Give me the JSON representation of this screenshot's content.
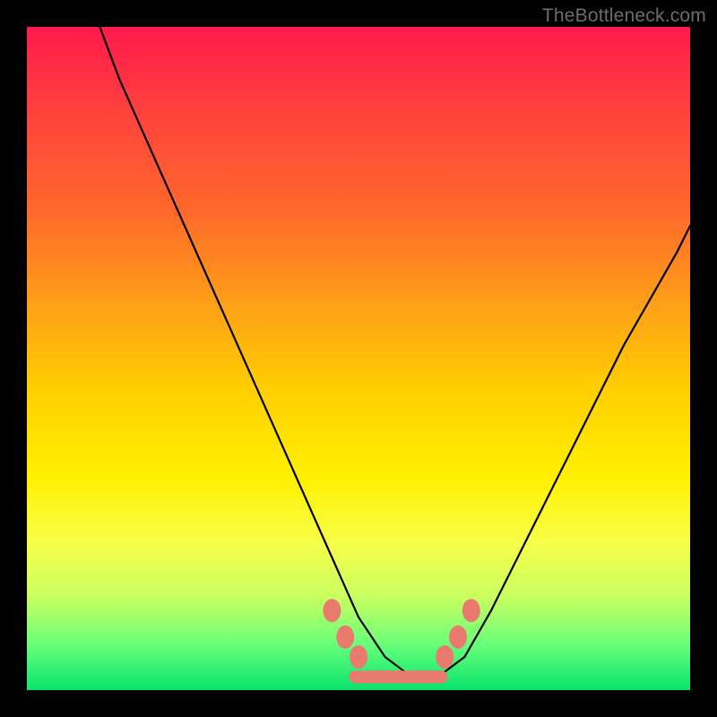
{
  "watermark": "TheBottleneck.com",
  "chart_data": {
    "type": "line",
    "title": "",
    "xlabel": "",
    "ylabel": "",
    "xlim": [
      0,
      100
    ],
    "ylim": [
      0,
      100
    ],
    "series": [
      {
        "name": "bottleneck-curve",
        "x": [
          11,
          14,
          18,
          22,
          26,
          30,
          34,
          38,
          42,
          46,
          50,
          54,
          58,
          62,
          66,
          70,
          74,
          78,
          82,
          86,
          90,
          94,
          98,
          100
        ],
        "values": [
          100,
          92,
          83,
          74,
          65,
          56,
          47,
          38,
          29,
          20,
          11,
          5,
          2,
          2,
          5,
          12,
          20,
          28,
          36,
          44,
          52,
          59,
          66,
          70
        ]
      }
    ],
    "markers": [
      {
        "name": "left-cluster-1",
        "x": 46,
        "y": 12
      },
      {
        "name": "left-cluster-2",
        "x": 48,
        "y": 8
      },
      {
        "name": "left-cluster-3",
        "x": 50,
        "y": 5
      },
      {
        "name": "valley-bar",
        "x": 56,
        "y": 2
      },
      {
        "name": "right-cluster-1",
        "x": 63,
        "y": 5
      },
      {
        "name": "right-cluster-2",
        "x": 65,
        "y": 8
      },
      {
        "name": "right-cluster-3",
        "x": 67,
        "y": 12
      }
    ],
    "marker_color": "#e87a6e",
    "curve_color": "#000000"
  }
}
